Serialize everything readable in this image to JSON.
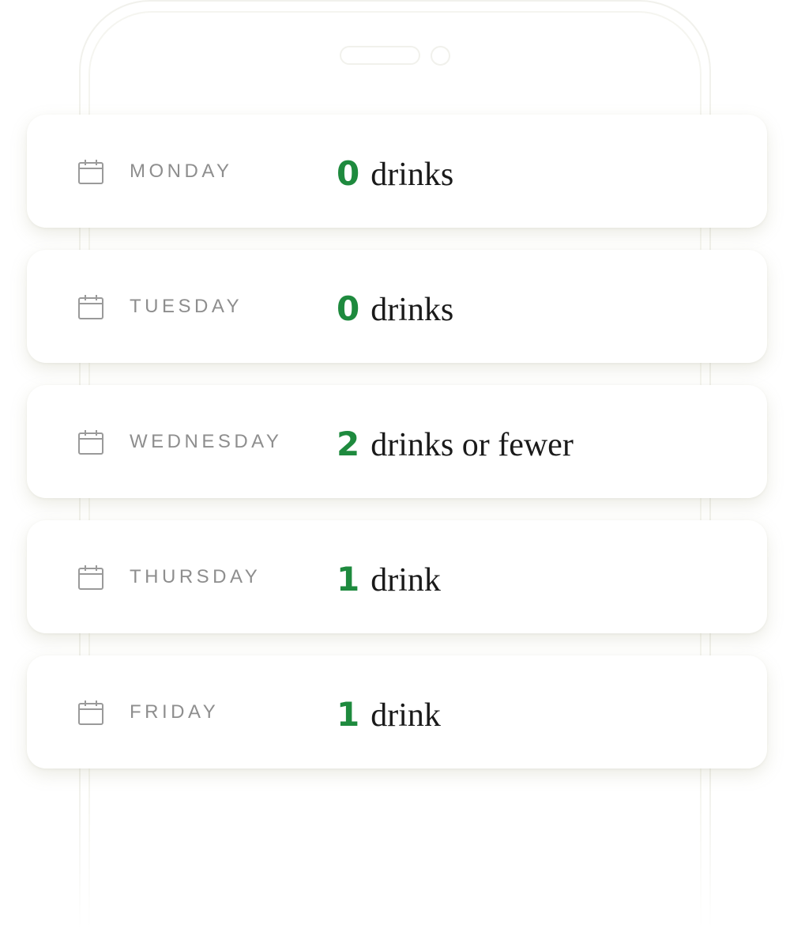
{
  "days": [
    {
      "day": "MONDAY",
      "count": "0",
      "unit": "drinks"
    },
    {
      "day": "TUESDAY",
      "count": "0",
      "unit": "drinks"
    },
    {
      "day": "WEDNESDAY",
      "count": "2",
      "unit": "drinks or fewer"
    },
    {
      "day": "THURSDAY",
      "count": "1",
      "unit": "drink"
    },
    {
      "day": "FRIDAY",
      "count": "1",
      "unit": "drink"
    }
  ],
  "colors": {
    "accent": "#1e8a3e",
    "label": "#8e8e8e",
    "text": "#1a1a1a"
  },
  "icons": {
    "row": "calendar-icon"
  }
}
